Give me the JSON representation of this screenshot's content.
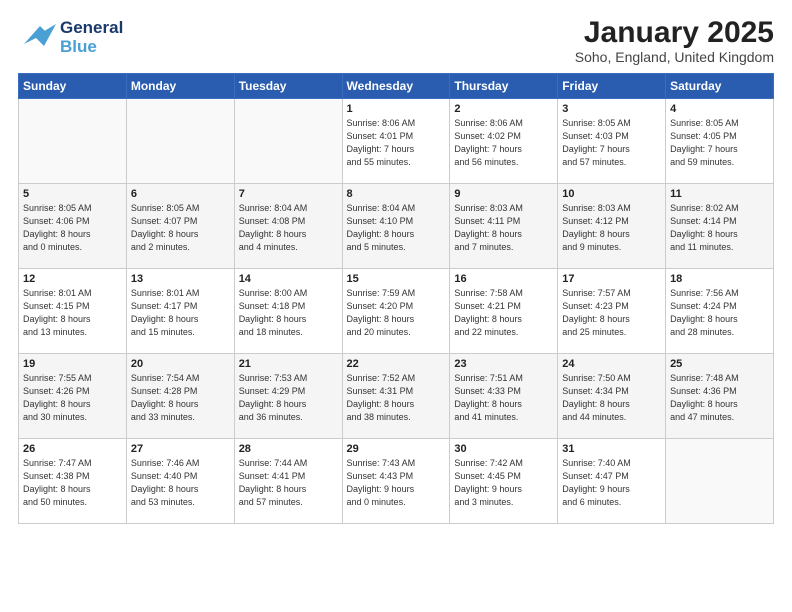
{
  "header": {
    "logo_line1": "General",
    "logo_line2": "Blue",
    "title": "January 2025",
    "subtitle": "Soho, England, United Kingdom"
  },
  "weekdays": [
    "Sunday",
    "Monday",
    "Tuesday",
    "Wednesday",
    "Thursday",
    "Friday",
    "Saturday"
  ],
  "weeks": [
    [
      {
        "num": "",
        "info": ""
      },
      {
        "num": "",
        "info": ""
      },
      {
        "num": "",
        "info": ""
      },
      {
        "num": "1",
        "info": "Sunrise: 8:06 AM\nSunset: 4:01 PM\nDaylight: 7 hours\nand 55 minutes."
      },
      {
        "num": "2",
        "info": "Sunrise: 8:06 AM\nSunset: 4:02 PM\nDaylight: 7 hours\nand 56 minutes."
      },
      {
        "num": "3",
        "info": "Sunrise: 8:05 AM\nSunset: 4:03 PM\nDaylight: 7 hours\nand 57 minutes."
      },
      {
        "num": "4",
        "info": "Sunrise: 8:05 AM\nSunset: 4:05 PM\nDaylight: 7 hours\nand 59 minutes."
      }
    ],
    [
      {
        "num": "5",
        "info": "Sunrise: 8:05 AM\nSunset: 4:06 PM\nDaylight: 8 hours\nand 0 minutes."
      },
      {
        "num": "6",
        "info": "Sunrise: 8:05 AM\nSunset: 4:07 PM\nDaylight: 8 hours\nand 2 minutes."
      },
      {
        "num": "7",
        "info": "Sunrise: 8:04 AM\nSunset: 4:08 PM\nDaylight: 8 hours\nand 4 minutes."
      },
      {
        "num": "8",
        "info": "Sunrise: 8:04 AM\nSunset: 4:10 PM\nDaylight: 8 hours\nand 5 minutes."
      },
      {
        "num": "9",
        "info": "Sunrise: 8:03 AM\nSunset: 4:11 PM\nDaylight: 8 hours\nand 7 minutes."
      },
      {
        "num": "10",
        "info": "Sunrise: 8:03 AM\nSunset: 4:12 PM\nDaylight: 8 hours\nand 9 minutes."
      },
      {
        "num": "11",
        "info": "Sunrise: 8:02 AM\nSunset: 4:14 PM\nDaylight: 8 hours\nand 11 minutes."
      }
    ],
    [
      {
        "num": "12",
        "info": "Sunrise: 8:01 AM\nSunset: 4:15 PM\nDaylight: 8 hours\nand 13 minutes."
      },
      {
        "num": "13",
        "info": "Sunrise: 8:01 AM\nSunset: 4:17 PM\nDaylight: 8 hours\nand 15 minutes."
      },
      {
        "num": "14",
        "info": "Sunrise: 8:00 AM\nSunset: 4:18 PM\nDaylight: 8 hours\nand 18 minutes."
      },
      {
        "num": "15",
        "info": "Sunrise: 7:59 AM\nSunset: 4:20 PM\nDaylight: 8 hours\nand 20 minutes."
      },
      {
        "num": "16",
        "info": "Sunrise: 7:58 AM\nSunset: 4:21 PM\nDaylight: 8 hours\nand 22 minutes."
      },
      {
        "num": "17",
        "info": "Sunrise: 7:57 AM\nSunset: 4:23 PM\nDaylight: 8 hours\nand 25 minutes."
      },
      {
        "num": "18",
        "info": "Sunrise: 7:56 AM\nSunset: 4:24 PM\nDaylight: 8 hours\nand 28 minutes."
      }
    ],
    [
      {
        "num": "19",
        "info": "Sunrise: 7:55 AM\nSunset: 4:26 PM\nDaylight: 8 hours\nand 30 minutes."
      },
      {
        "num": "20",
        "info": "Sunrise: 7:54 AM\nSunset: 4:28 PM\nDaylight: 8 hours\nand 33 minutes."
      },
      {
        "num": "21",
        "info": "Sunrise: 7:53 AM\nSunset: 4:29 PM\nDaylight: 8 hours\nand 36 minutes."
      },
      {
        "num": "22",
        "info": "Sunrise: 7:52 AM\nSunset: 4:31 PM\nDaylight: 8 hours\nand 38 minutes."
      },
      {
        "num": "23",
        "info": "Sunrise: 7:51 AM\nSunset: 4:33 PM\nDaylight: 8 hours\nand 41 minutes."
      },
      {
        "num": "24",
        "info": "Sunrise: 7:50 AM\nSunset: 4:34 PM\nDaylight: 8 hours\nand 44 minutes."
      },
      {
        "num": "25",
        "info": "Sunrise: 7:48 AM\nSunset: 4:36 PM\nDaylight: 8 hours\nand 47 minutes."
      }
    ],
    [
      {
        "num": "26",
        "info": "Sunrise: 7:47 AM\nSunset: 4:38 PM\nDaylight: 8 hours\nand 50 minutes."
      },
      {
        "num": "27",
        "info": "Sunrise: 7:46 AM\nSunset: 4:40 PM\nDaylight: 8 hours\nand 53 minutes."
      },
      {
        "num": "28",
        "info": "Sunrise: 7:44 AM\nSunset: 4:41 PM\nDaylight: 8 hours\nand 57 minutes."
      },
      {
        "num": "29",
        "info": "Sunrise: 7:43 AM\nSunset: 4:43 PM\nDaylight: 9 hours\nand 0 minutes."
      },
      {
        "num": "30",
        "info": "Sunrise: 7:42 AM\nSunset: 4:45 PM\nDaylight: 9 hours\nand 3 minutes."
      },
      {
        "num": "31",
        "info": "Sunrise: 7:40 AM\nSunset: 4:47 PM\nDaylight: 9 hours\nand 6 minutes."
      },
      {
        "num": "",
        "info": ""
      }
    ]
  ]
}
